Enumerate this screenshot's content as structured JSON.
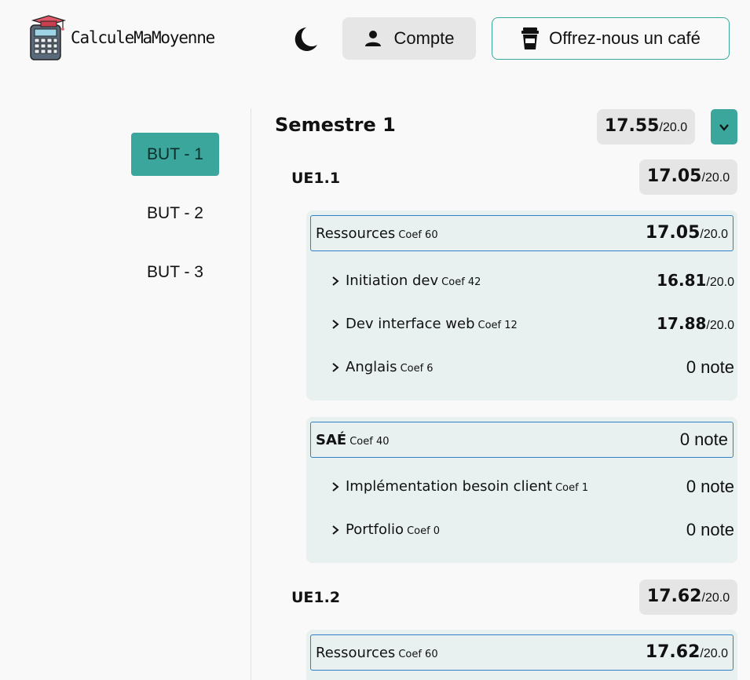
{
  "header": {
    "app_title": "CalculeMaMoyenne",
    "logo_icon": "calculator-graduation-cap-icon",
    "theme_icon": "moon-icon",
    "account_label": "Compte",
    "account_icon": "user-icon",
    "coffee_label": "Offrez-nous un café",
    "coffee_icon": "coffee-cup-icon"
  },
  "sidebar": {
    "items": [
      {
        "label": "BUT - 1",
        "active": true
      },
      {
        "label": "BUT - 2",
        "active": false
      },
      {
        "label": "BUT - 3",
        "active": false
      }
    ]
  },
  "semester": {
    "title": "Semestre 1",
    "grade": "17.55",
    "max": "/20.0",
    "collapse_icon": "chevron-down-icon"
  },
  "ues": [
    {
      "title": "UE1.1",
      "grade": "17.05",
      "max": "/20.0",
      "groups": [
        {
          "name": "Ressources",
          "coef": "Coef 60",
          "grade": "17.05",
          "max": "/20.0",
          "items": [
            {
              "label": "Initiation dev",
              "coef": "Coef 42",
              "grade": "16.81",
              "max": "/20.0"
            },
            {
              "label": "Dev interface web",
              "coef": "Coef 12",
              "grade": "17.88",
              "max": "/20.0"
            },
            {
              "label": "Anglais",
              "coef": "Coef 6",
              "note": "0 note"
            }
          ]
        },
        {
          "name": "SAÉ",
          "coef": "Coef 40",
          "note": "0 note",
          "items": [
            {
              "label": "Implémentation besoin client",
              "coef": "Coef 1",
              "note": "0 note"
            },
            {
              "label": "Portfolio",
              "coef": "Coef 0",
              "note": "0 note"
            }
          ]
        }
      ]
    },
    {
      "title": "UE1.2",
      "grade": "17.62",
      "max": "/20.0",
      "groups": [
        {
          "name": "Ressources",
          "coef": "Coef 60",
          "grade": "17.62",
          "max": "/20.0",
          "items": []
        }
      ]
    }
  ],
  "colors": {
    "accent": "#3aa69c",
    "chip": "#e5e5e5",
    "group_bg": "#e8f0f0",
    "group_border": "#2f80c8"
  }
}
